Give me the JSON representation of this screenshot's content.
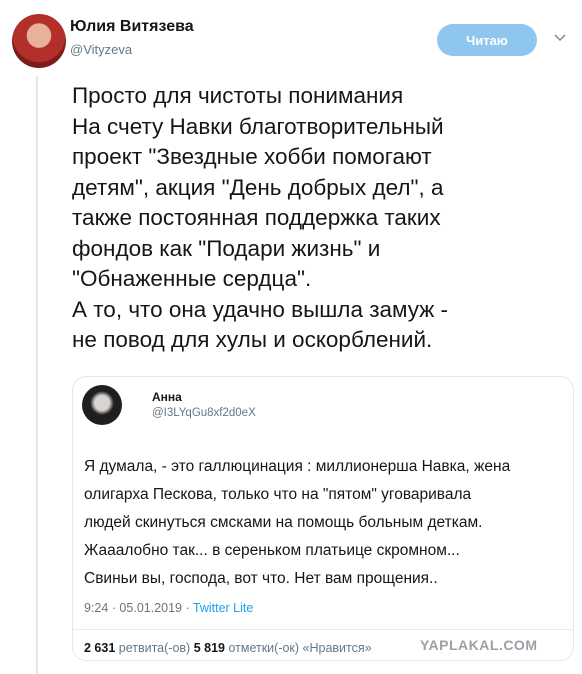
{
  "author": {
    "name": "Юлия Витязева",
    "handle": "@Vityzeva",
    "avatar_icon": "avatar-photo"
  },
  "follow_button": {
    "label": "Читаю"
  },
  "menu_icon": "chevron-down-icon",
  "tweet": {
    "lines": [
      "Просто для чистоты понимания",
      "На счету Навки благотворительный",
      "проект \"Звездные хобби помогают",
      "детям\", акция \"День добрых дел\", а",
      "также постоянная поддержка таких",
      "фондов как \"Подари жизнь\" и",
      "\"Обнаженные сердца\".",
      "А то, что она удачно вышла замуж -",
      "не повод для хулы и оскорблений."
    ]
  },
  "quoted": {
    "name": "Анна",
    "handle": "@I3LYqGu8xf2d0eX",
    "lines": [
      "Я думала, - это галлюцинация : миллионерша Навка, жена",
      "олигарха Пескова, только что на \"пятом\" уговаривала",
      "людей скинуться смсками на помощь больным деткам.",
      "Жааалобно так... в сереньком платьице скромном...",
      "Свиньи вы, господа,  вот что. Нет вам прощения.."
    ],
    "time": "9:24 · 05.01.2019 · ",
    "source": "Twitter Lite",
    "retweets_count": "2 631",
    "retweets_label": " ретвита(-ов)  ",
    "likes_count": "5 819",
    "likes_label": " отметки(-ок) «Нравится»"
  },
  "watermark": "YAPLAKAL.COM",
  "colors": {
    "follow_bg": "#8fc6ee",
    "link": "#1da1f2",
    "muted": "#657786"
  }
}
